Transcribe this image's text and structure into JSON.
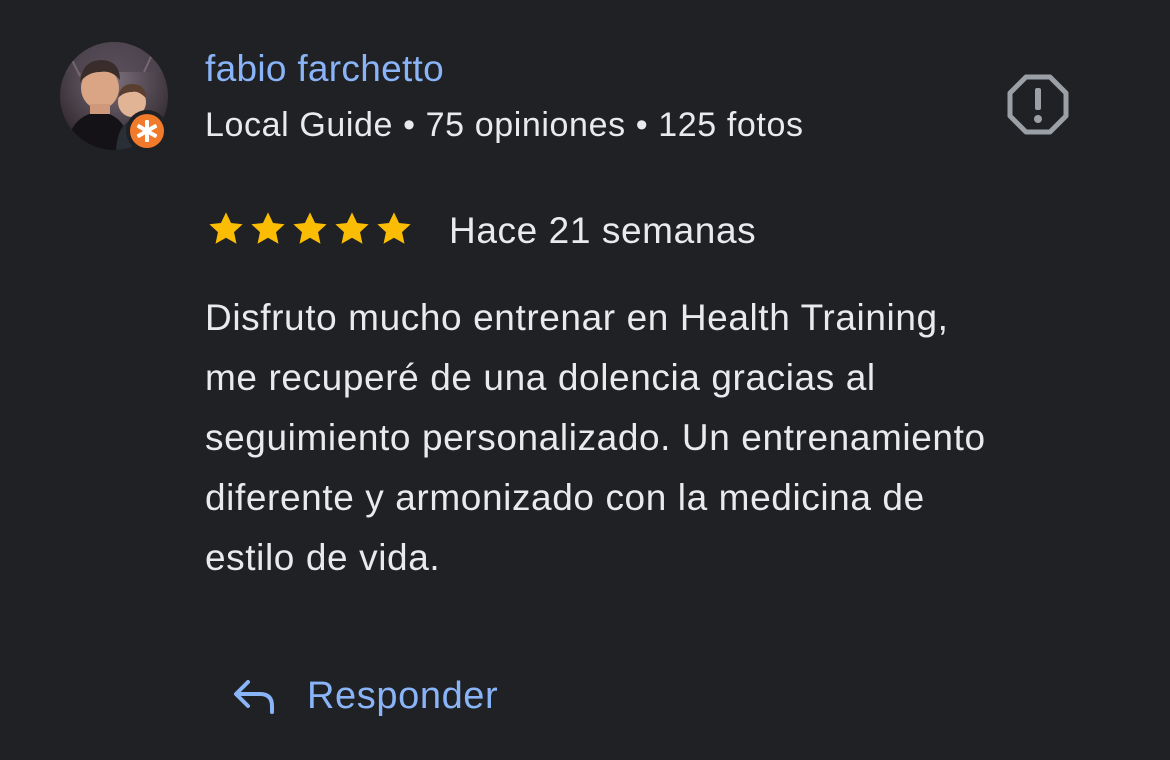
{
  "reviewer": {
    "name": "fabio farchetto",
    "meta": "Local Guide • 75 opiniones • 125 fotos",
    "avatar_icon": "user-photo-avatar",
    "badge_icon": "local-guide-star-badge",
    "badge_color": "#f17a2b"
  },
  "report": {
    "icon": "report-flag-icon"
  },
  "review": {
    "rating": 5,
    "rating_max": 5,
    "star_color": "#fbbc04",
    "date": "Hace 21 semanas",
    "text_lines": [
      "Disfruto mucho entrenar en Health Training,",
      "me recuperé de una dolencia gracias al",
      "seguimiento personalizado. Un entrenamiento",
      "diferente y armonizado con la medicina de",
      "estilo de vida."
    ]
  },
  "actions": {
    "reply_label": "Responder",
    "reply_icon": "reply-arrow-icon"
  },
  "colors": {
    "background": "#202124",
    "text": "#e8eaed",
    "link": "#8ab4f8",
    "icon_gray": "#9aa0a6"
  }
}
